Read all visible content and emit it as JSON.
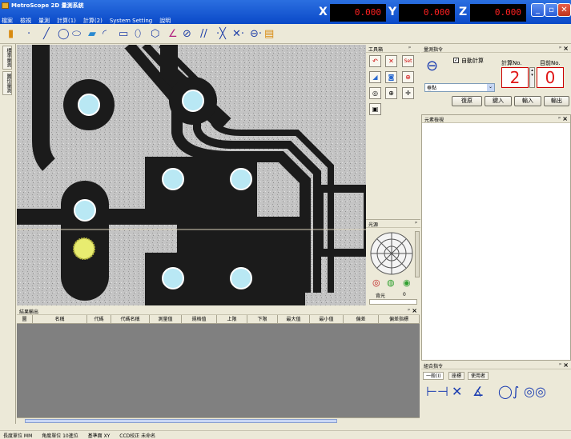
{
  "app": {
    "title": "MetroScope 2D 量測系統"
  },
  "menu": [
    "檔案",
    "檢視",
    "量測",
    "計算(1)",
    "計算(2)",
    "System Setting",
    "說明"
  ],
  "coords": {
    "x_label": "X",
    "x_value": "0.000",
    "y_label": "Y",
    "y_value": "0.000",
    "z_label": "Z",
    "z_value": "0.000"
  },
  "sidebar": {
    "tab1": "標準量測",
    "tab2": "圖形量測"
  },
  "toolbox": {
    "title": "工具箱",
    "set_label": "Set"
  },
  "measure": {
    "title": "量測指令",
    "auto_calc": "自動計算",
    "calc_no_label": "計算No.",
    "calc_no": "2",
    "current_no_label": "目前No.",
    "current_no": "0",
    "select_value": "垂點",
    "btn_reset": "復原",
    "btn_enter": "鍵入",
    "btn_input": "輸入",
    "btn_output": "輸出"
  },
  "elements": {
    "title": "元素檢視"
  },
  "light": {
    "title": "光源",
    "backlight_label": "背光",
    "backlight_value": "0"
  },
  "results": {
    "title": "結果輸出",
    "columns": [
      "圖",
      "名稱",
      "代碼",
      "代碼名稱",
      "測量值",
      "規格值",
      "上限",
      "下限",
      "最大值",
      "最小值",
      "偏差",
      "偏差指標"
    ]
  },
  "combo": {
    "title": "組合指令",
    "tabs": [
      "一般(I)",
      "座標",
      "使用者"
    ]
  },
  "status": [
    "長度單位 MM",
    "角度單位 10進位",
    "基準面 XY",
    "CCD校正 未命名"
  ],
  "icons": {
    "window_min": "minimize-icon",
    "window_max": "maximize-icon",
    "window_close": "close-icon"
  }
}
